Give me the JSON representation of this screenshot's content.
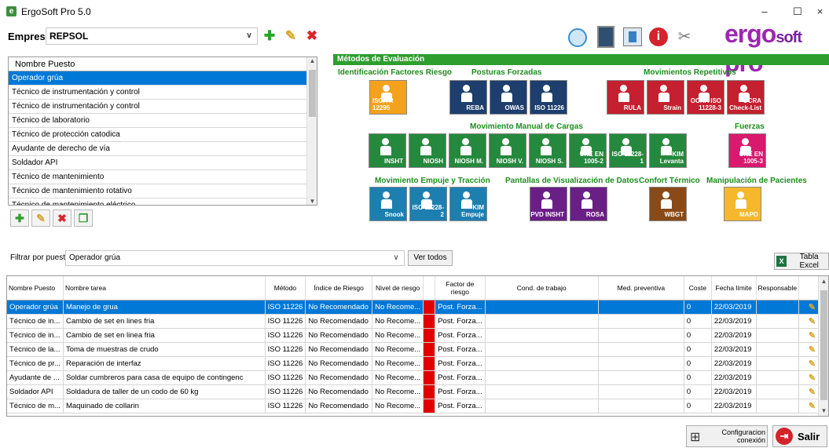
{
  "window": {
    "title": "ErgoSoft Pro 5.0",
    "icon_letter": "e",
    "minimize": "–",
    "maximize": "☐",
    "close": "×"
  },
  "empresa": {
    "label": "Empresa:",
    "value": "REPSOL"
  },
  "toolbar_icons": [
    "refresh-icon",
    "door-icon",
    "database-icon",
    "info-icon",
    "tools-icon"
  ],
  "logo": {
    "main": "ergo",
    "soft": "soft",
    "pro": "pro"
  },
  "puestos": {
    "header": "Nombre Puesto",
    "items": [
      "Operador grúa",
      "Técnico de instrumentación y control",
      "Técnico de instrumentación y control",
      "Técnico de laboratorio",
      "Técnico de protección catodica",
      "Ayudante de derecho de vía",
      "Soldador API",
      "Técnico de mantenimiento",
      "Técnico de mantenimiento rotativo",
      "Técnico de mantenimiento eléctrico"
    ],
    "selected_index": 0
  },
  "metodos": {
    "title": "Métodos de Evaluación",
    "groups": {
      "identificacion": "Identificación Factores Riesgo",
      "posturas": "Posturas Forzadas",
      "repetitivos": "Movimientos Repetitivos",
      "manual": "Movimiento Manual de Cargas",
      "fuerzas": "Fuerzas",
      "empuje": "Movimiento Empuje y Tracción",
      "pantallas": "Pantallas de Visualización de Datos",
      "termico": "Confort Térmico",
      "pacientes": "Manipulación de Pacientes"
    },
    "buttons": {
      "iso_tr_12295": "ISO/TR 12295",
      "reba": "REBA",
      "owas": "OWAS",
      "iso_11226": "ISO 11226",
      "rula": "RULA",
      "strain": "Strain",
      "ocra_iso": "OCRA ISO 11228-3",
      "ocra_check": "OCRA Check-List",
      "insht": "INSHT",
      "niosh": "NIOSH",
      "niosh_m": "NIOSH M.",
      "niosh_v": "NIOSH V.",
      "niosh_s": "NIOSH S.",
      "une_1005_2": "UNE EN 1005-2",
      "iso_11228_1": "ISO 11228-1",
      "kim_levanta": "KIM Levanta",
      "une_1005_3": "UNE EN 1005-3",
      "snook": "Snook",
      "iso_11228_2": "ISO 11228-2",
      "kim_empuje": "KIM Empuje",
      "pvd_insht": "PVD INSHT",
      "rosa": "ROSA",
      "wbgt": "WBGT",
      "mapo": "MAPO"
    }
  },
  "filtro": {
    "label": "Filtrar por puesto",
    "value": "Operador grúa",
    "ver_todos": "Ver todos"
  },
  "excel_button": "Tabla Excel",
  "tareas": {
    "columns": [
      "Nombre Puesto",
      "Nombre tarea",
      "Método",
      "Índice de Riesgo",
      "Nivel de riesgo",
      "",
      "Factor de riesgo",
      "Cond. de trabajo",
      "Med. preventiva",
      "Coste",
      "Fecha límite",
      "Responsable",
      ""
    ],
    "rows": [
      {
        "puesto": "Operador grúa",
        "tarea": "Manejo de grua",
        "metodo": "ISO 11226",
        "indice": "No Recomendado",
        "nivel": "No Recome...",
        "factor": "Post. Forza...",
        "cond": "",
        "med": "",
        "coste": "0",
        "fecha": "22/03/2019",
        "resp": ""
      },
      {
        "puesto": "Técnico de in...",
        "tarea": "Cambio de set en lines fria",
        "metodo": "ISO 11226",
        "indice": "No Recomendado",
        "nivel": "No Recome...",
        "factor": "Post. Forza...",
        "cond": "",
        "med": "",
        "coste": "0",
        "fecha": "22/03/2019",
        "resp": ""
      },
      {
        "puesto": "Técnico de in...",
        "tarea": "Cambio de set en linea fria",
        "metodo": "ISO 11226",
        "indice": "No Recomendado",
        "nivel": "No Recome...",
        "factor": "Post. Forza...",
        "cond": "",
        "med": "",
        "coste": "0",
        "fecha": "22/03/2019",
        "resp": ""
      },
      {
        "puesto": "Técnico de la...",
        "tarea": "Toma de muestras de crudo",
        "metodo": "ISO 11226",
        "indice": "No Recomendado",
        "nivel": "No Recome...",
        "factor": "Post. Forza...",
        "cond": "",
        "med": "",
        "coste": "0",
        "fecha": "22/03/2019",
        "resp": ""
      },
      {
        "puesto": "Técnico de pr...",
        "tarea": "Reparación de interfaz",
        "metodo": "ISO 11226",
        "indice": "No Recomendado",
        "nivel": "No Recome...",
        "factor": "Post. Forza...",
        "cond": "",
        "med": "",
        "coste": "0",
        "fecha": "22/03/2019",
        "resp": ""
      },
      {
        "puesto": "Ayudante de ...",
        "tarea": "Soldar cumbreros para casa de equipo de contingenc",
        "metodo": "ISO 11226",
        "indice": "No Recomendado",
        "nivel": "No Recome...",
        "factor": "Post. Forza...",
        "cond": "",
        "med": "",
        "coste": "0",
        "fecha": "22/03/2019",
        "resp": ""
      },
      {
        "puesto": "Soldador API",
        "tarea": "Soldadura de taller de un codo de 60 kg",
        "metodo": "ISO 11226",
        "indice": "No Recomendado",
        "nivel": "No Recome...",
        "factor": "Post. Forza...",
        "cond": "",
        "med": "",
        "coste": "0",
        "fecha": "22/03/2019",
        "resp": ""
      },
      {
        "puesto": "Técnico de m...",
        "tarea": "Maquinado de collarin",
        "metodo": "ISO 11226",
        "indice": "No Recomendado",
        "nivel": "No Recome...",
        "factor": "Post. Forza...",
        "cond": "",
        "med": "",
        "coste": "0",
        "fecha": "22/03/2019",
        "resp": ""
      }
    ],
    "selected_index": 0
  },
  "footer": {
    "config_label_1": "Configuracion",
    "config_label_2": "conexión",
    "salir": "Salir"
  },
  "colors": {
    "accent": "#0078d7",
    "green": "#2e9e2e",
    "risk_red": "#e00000",
    "logo_purple": "#9c27b0"
  }
}
